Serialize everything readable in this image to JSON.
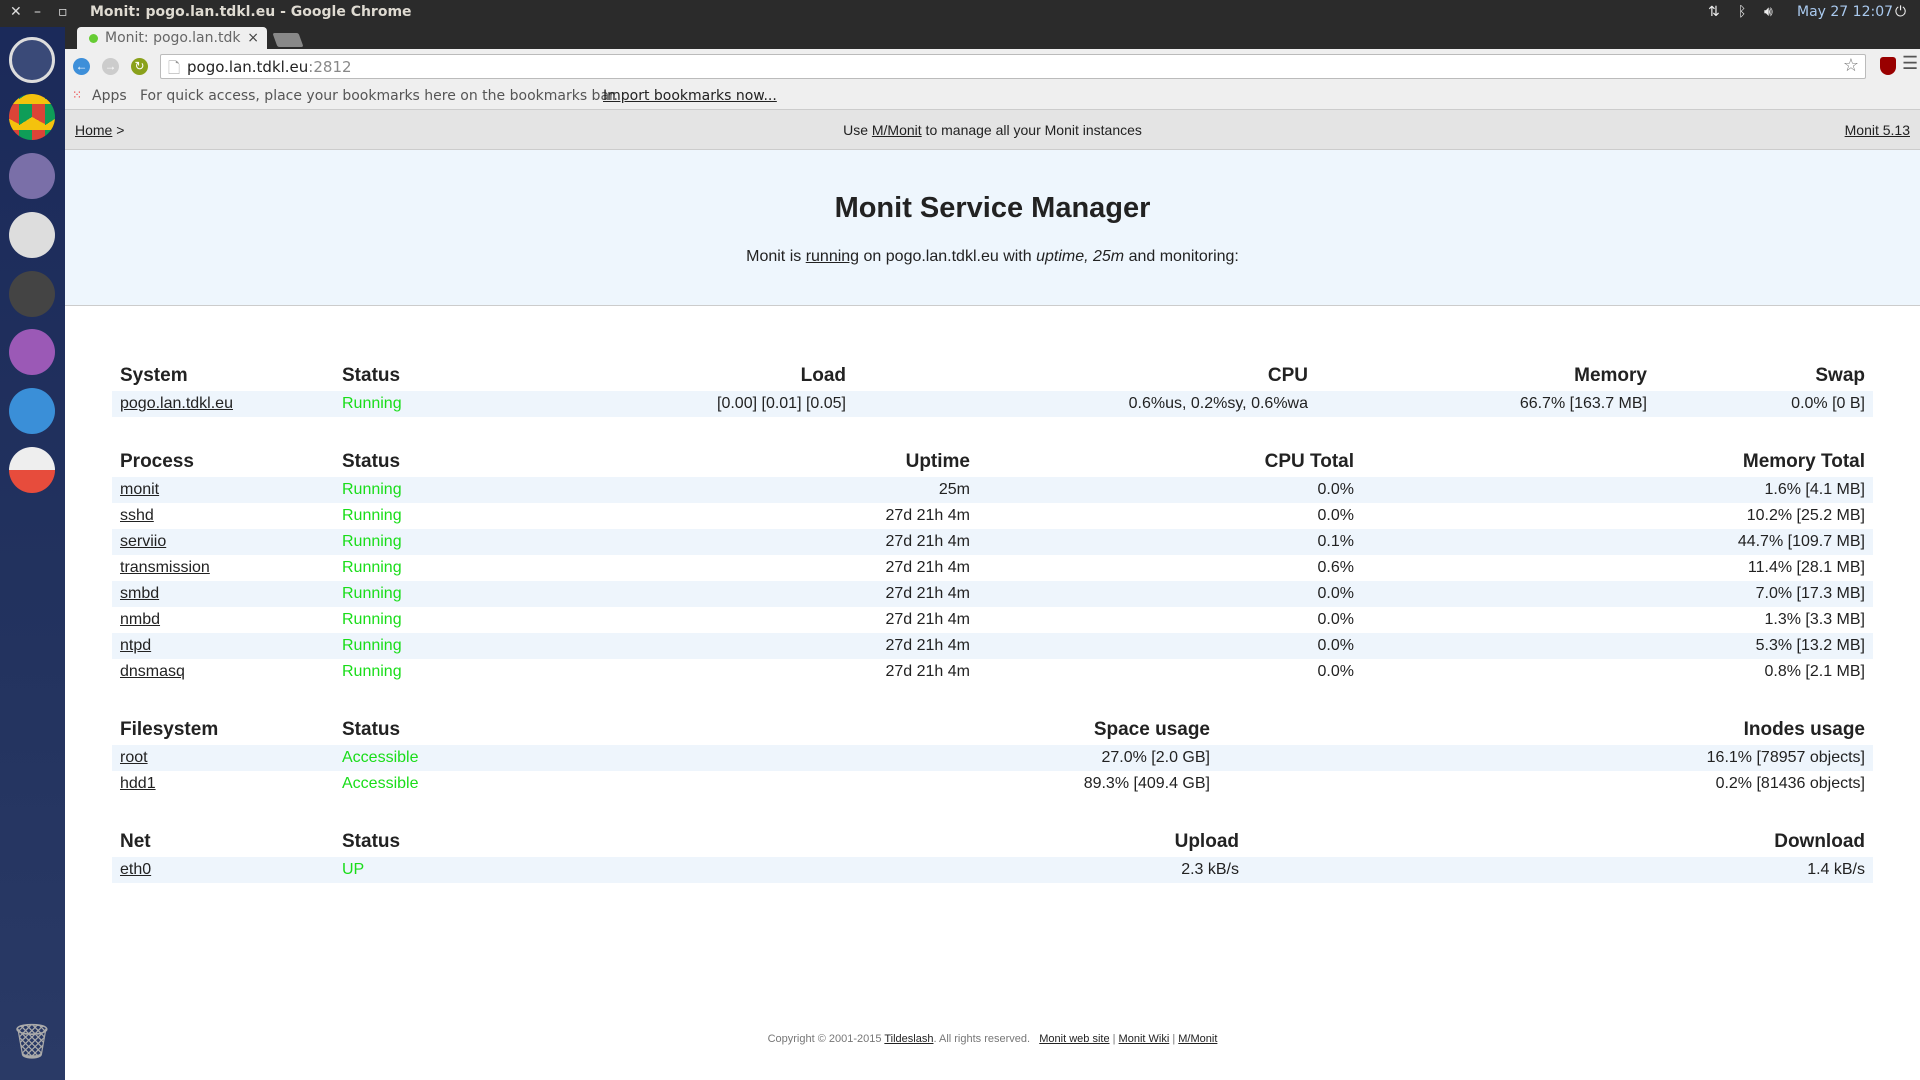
{
  "os": {
    "window_title": "Monit: pogo.lan.tdkl.eu - Google Chrome",
    "clock": "May 27 12:07"
  },
  "browser": {
    "tab_title": "Monit: pogo.lan.tdk",
    "url_host": "pogo.lan.tdkl.eu",
    "url_port": ":2812",
    "apps_label": "Apps",
    "bookmarks_hint": "For quick access, place your bookmarks here on the bookmarks bar.",
    "import_link": "Import bookmarks now..."
  },
  "nav": {
    "home": "Home",
    "sep": " >",
    "center_pre": "Use ",
    "center_link": "M/Monit",
    "center_post": " to manage all your Monit instances",
    "version": "Monit 5.13"
  },
  "header": {
    "title": "Monit Service Manager",
    "sub_pre": "Monit is ",
    "sub_link": "running",
    "sub_mid": " on pogo.lan.tdkl.eu with ",
    "sub_em": "uptime, 25m",
    "sub_post": "  and monitoring:"
  },
  "system": {
    "headers": [
      "System",
      "Status",
      "Load",
      "CPU",
      "Memory",
      "Swap"
    ],
    "rows": [
      [
        "pogo.lan.tdkl.eu",
        "Running",
        "[0.00] [0.01] [0.05]",
        "0.6%us, 0.2%sy, 0.6%wa",
        "66.7% [163.7 MB]",
        "0.0% [0 B]"
      ]
    ]
  },
  "process": {
    "headers": [
      "Process",
      "Status",
      "Uptime",
      "CPU Total",
      "Memory Total"
    ],
    "rows": [
      [
        "monit",
        "Running",
        "25m",
        "0.0%",
        "1.6% [4.1 MB]"
      ],
      [
        "sshd",
        "Running",
        "27d 21h 4m",
        "0.0%",
        "10.2% [25.2 MB]"
      ],
      [
        "serviio",
        "Running",
        "27d 21h 4m",
        "0.1%",
        "44.7% [109.7 MB]"
      ],
      [
        "transmission",
        "Running",
        "27d 21h 4m",
        "0.6%",
        "11.4% [28.1 MB]"
      ],
      [
        "smbd",
        "Running",
        "27d 21h 4m",
        "0.0%",
        "7.0% [17.3 MB]"
      ],
      [
        "nmbd",
        "Running",
        "27d 21h 4m",
        "0.0%",
        "1.3% [3.3 MB]"
      ],
      [
        "ntpd",
        "Running",
        "27d 21h 4m",
        "0.0%",
        "5.3% [13.2 MB]"
      ],
      [
        "dnsmasq",
        "Running",
        "27d 21h 4m",
        "0.0%",
        "0.8% [2.1 MB]"
      ]
    ]
  },
  "filesystem": {
    "headers": [
      "Filesystem",
      "Status",
      "Space usage",
      "Inodes usage"
    ],
    "rows": [
      [
        "root",
        "Accessible",
        "27.0% [2.0 GB]",
        "16.1% [78957 objects]"
      ],
      [
        "hdd1",
        "Accessible",
        "89.3% [409.4 GB]",
        "0.2% [81436 objects]"
      ]
    ]
  },
  "net": {
    "headers": [
      "Net",
      "Status",
      "Upload",
      "Download"
    ],
    "rows": [
      [
        "eth0",
        "UP",
        "2.3 kB/s",
        "1.4 kB/s"
      ]
    ]
  },
  "footer": {
    "copy": "Copyright © 2001-2015 ",
    "tilde": "Tildeslash",
    "rights": ". All rights reserved.   ",
    "site": "Monit web site",
    "wiki": "Monit Wiki",
    "mmonit": "M/Monit",
    "bar": " | "
  },
  "colors": {
    "ok": "#19dd19",
    "header_bg": "#eef6fd",
    "row_stripe": "#eef5fc"
  }
}
